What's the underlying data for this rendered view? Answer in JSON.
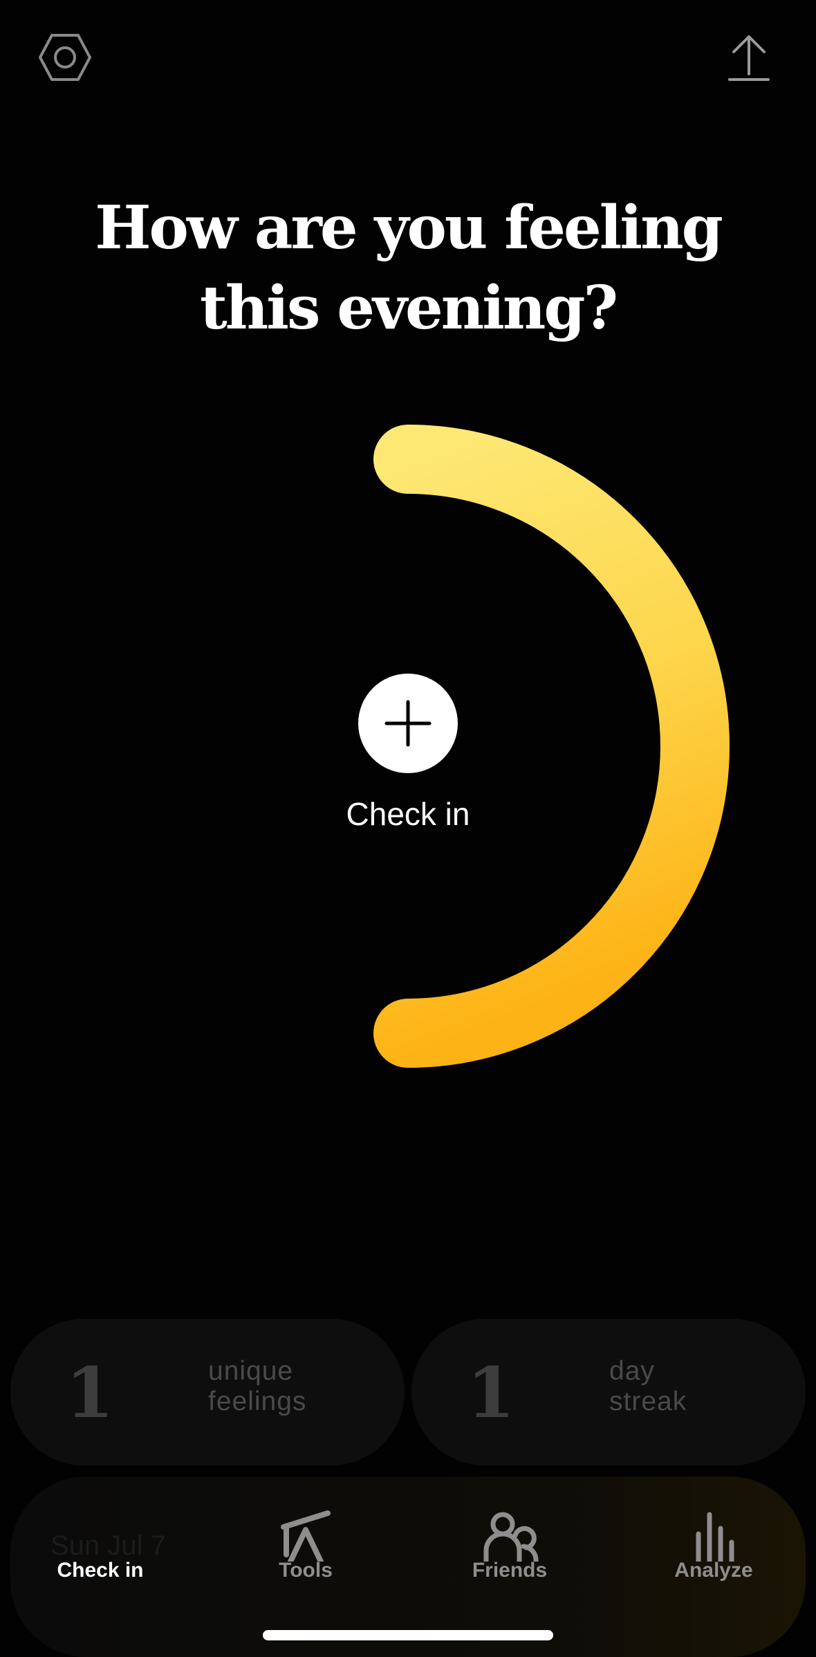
{
  "header": {
    "settings_icon": "hexagon-settings-icon",
    "share_icon": "share-upload-icon"
  },
  "prompt": {
    "line1": "How are you feeling",
    "line2": "this evening?"
  },
  "mood_arc": {
    "colors": [
      "#fde36a",
      "#fdd24a",
      "#fdb514"
    ]
  },
  "checkin": {
    "label": "Check in",
    "icon": "plus-icon"
  },
  "stats": [
    {
      "value": "1",
      "line1": "unique",
      "line2": "feelings"
    },
    {
      "value": "1",
      "line1": "day",
      "line2": "streak"
    }
  ],
  "background_card": {
    "text": "Sun Jul 7"
  },
  "tabs": [
    {
      "label": "Check in",
      "icon": "plus-multicolor-icon",
      "active": true
    },
    {
      "label": "Tools",
      "icon": "tools-icon",
      "active": false
    },
    {
      "label": "Friends",
      "icon": "friends-icon",
      "active": false
    },
    {
      "label": "Analyze",
      "icon": "bar-chart-icon",
      "active": false
    }
  ],
  "colors": {
    "background": "#030203",
    "accent_yellow": "#fdc22c",
    "tab_inactive": "#8e8e8e"
  }
}
